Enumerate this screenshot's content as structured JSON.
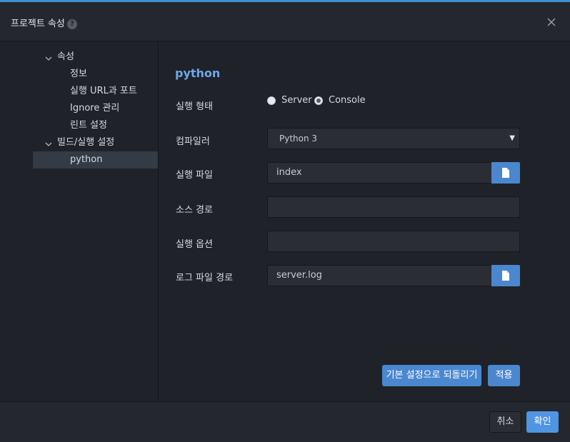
{
  "dialog": {
    "title": "프로젝트 속성",
    "help_glyph": "?",
    "accent_color": "#3d8fd6"
  },
  "sidebar": {
    "groups": [
      {
        "label": "속성",
        "items": [
          "정보",
          "실행 URL과 포트",
          "Ignore 관리",
          "린트 설정"
        ]
      },
      {
        "label": "빌드/실행 설정",
        "items": [
          "python"
        ]
      }
    ],
    "selected": "python"
  },
  "main": {
    "section_title": "python",
    "run_type": {
      "label": "실행 형태",
      "options": [
        "Server",
        "Console"
      ],
      "selected": "Console"
    },
    "compiler": {
      "label": "컴파일러",
      "value": "Python 3",
      "arrow": "▼"
    },
    "run_file": {
      "label": "실행 파일",
      "value": "index"
    },
    "source_path": {
      "label": "소스 경로",
      "value": ""
    },
    "run_options": {
      "label": "실행 옵션",
      "value": ""
    },
    "log_path": {
      "label": "로그 파일 경로",
      "value": "server.log"
    },
    "reset_button": "기본 설정으로 되돌리기",
    "apply_button": "적용"
  },
  "footer": {
    "cancel_button": "취소",
    "ok_button": "확인"
  }
}
